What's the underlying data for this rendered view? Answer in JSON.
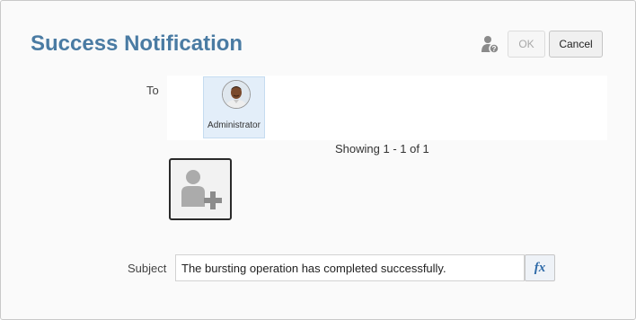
{
  "dialog": {
    "title": "Success Notification",
    "ok_label": "OK",
    "cancel_label": "Cancel",
    "help_icon": "user-help-icon"
  },
  "recipients": {
    "to_label": "To",
    "items": [
      {
        "name": "Administrator",
        "icon": "avatar"
      }
    ],
    "showing_text": "Showing 1 - 1 of 1",
    "add_icon": "add-user-icon"
  },
  "subject": {
    "label": "Subject",
    "value": "The bursting operation has completed successfully.",
    "fx_label": "fx"
  },
  "colors": {
    "title": "#4a7ba3",
    "recipient_selected_bg": "#e3eef9",
    "fx_color": "#2e6aa8"
  }
}
